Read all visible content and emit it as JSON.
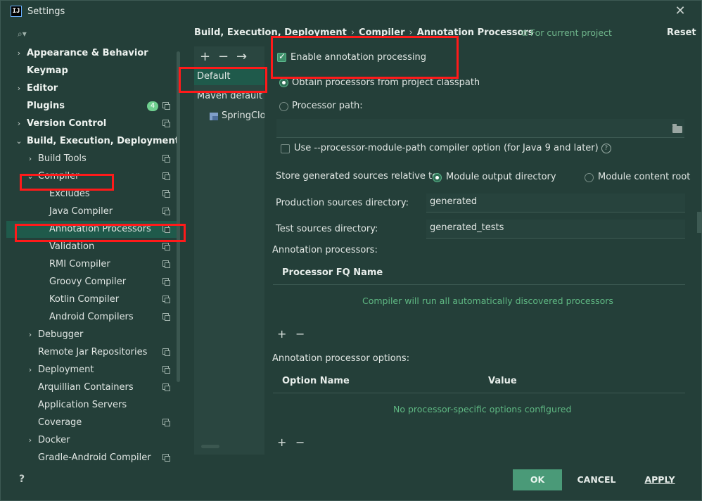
{
  "window": {
    "app_icon": "intellij-icon",
    "title": "Settings",
    "close_glyph": "✕"
  },
  "search": {
    "icon": "search-icon",
    "glyph": "⌕▾"
  },
  "tree": [
    {
      "label": "Appearance & Behavior",
      "arrow": "›",
      "bold": true,
      "copy": false
    },
    {
      "label": "Keymap",
      "arrow": "",
      "bold": true,
      "copy": false
    },
    {
      "label": "Editor",
      "arrow": "›",
      "bold": true,
      "copy": false
    },
    {
      "label": "Plugins",
      "arrow": "",
      "bold": true,
      "copy": true,
      "badge": "4"
    },
    {
      "label": "Version Control",
      "arrow": "›",
      "bold": true,
      "copy": true
    },
    {
      "label": "Build, Execution, Deployment",
      "arrow": "⌄",
      "bold": true,
      "copy": false
    },
    {
      "label": "Build Tools",
      "arrow": "›",
      "bold": false,
      "copy": true
    },
    {
      "label": "Compiler",
      "arrow": "⌄",
      "bold": false,
      "copy": true
    },
    {
      "label": "Excludes",
      "arrow": "",
      "bold": false,
      "copy": true
    },
    {
      "label": "Java Compiler",
      "arrow": "",
      "bold": false,
      "copy": true
    },
    {
      "label": "Annotation Processors",
      "arrow": "",
      "bold": false,
      "copy": true,
      "selected": true
    },
    {
      "label": "Validation",
      "arrow": "",
      "bold": false,
      "copy": true
    },
    {
      "label": "RMI Compiler",
      "arrow": "",
      "bold": false,
      "copy": true
    },
    {
      "label": "Groovy Compiler",
      "arrow": "",
      "bold": false,
      "copy": true
    },
    {
      "label": "Kotlin Compiler",
      "arrow": "",
      "bold": false,
      "copy": true
    },
    {
      "label": "Android Compilers",
      "arrow": "",
      "bold": false,
      "copy": true
    },
    {
      "label": "Debugger",
      "arrow": "›",
      "bold": false,
      "copy": false
    },
    {
      "label": "Remote Jar Repositories",
      "arrow": "",
      "bold": false,
      "copy": true
    },
    {
      "label": "Deployment",
      "arrow": "›",
      "bold": false,
      "copy": true
    },
    {
      "label": "Arquillian Containers",
      "arrow": "",
      "bold": false,
      "copy": true
    },
    {
      "label": "Application Servers",
      "arrow": "",
      "bold": false,
      "copy": false
    },
    {
      "label": "Coverage",
      "arrow": "",
      "bold": false,
      "copy": true
    },
    {
      "label": "Docker",
      "arrow": "›",
      "bold": false,
      "copy": false
    },
    {
      "label": "Gradle-Android Compiler",
      "arrow": "",
      "bold": false,
      "copy": true
    }
  ],
  "breadcrumb": {
    "parts": [
      "Build, Execution, Deployment",
      "Compiler",
      "Annotation Processors"
    ],
    "separator": "›",
    "for_project": "For current project",
    "reset": "Reset"
  },
  "profiles": {
    "tools": [
      "+",
      "−",
      "→"
    ],
    "items": [
      "Default",
      "Maven default a",
      "SpringClo"
    ]
  },
  "processing": {
    "enable_label": "Enable annotation processing",
    "enable_checked": true,
    "obtain_label": "Obtain processors from project classpath",
    "processor_path_label": "Processor path:",
    "processor_path_value": "",
    "module_path_label": "Use --processor-module-path compiler option (for Java 9 and later)",
    "module_path_checked": false,
    "help_glyph": "?",
    "store_label": "Store generated sources relative to:",
    "store_options": [
      "Module output directory",
      "Module content root"
    ],
    "store_selected": "Module output directory",
    "prod_label": "Production sources directory:",
    "prod_value": "generated",
    "test_label": "Test sources directory:",
    "test_value": "generated_tests"
  },
  "processors_table": {
    "title": "Annotation processors:",
    "column": "Processor FQ Name",
    "empty": "Compiler will run all automatically discovered processors",
    "add": "+",
    "remove": "−"
  },
  "options_table": {
    "title": "Annotation processor options:",
    "columns": [
      "Option Name",
      "Value"
    ],
    "empty": "No processor-specific options configured",
    "add": "+",
    "remove": "−"
  },
  "footer": {
    "help": "?",
    "ok": "OK",
    "cancel": "CANCEL",
    "apply": "APPLY"
  },
  "colors": {
    "background": "#243f39",
    "selection": "#1f5a4b",
    "accent_green": "#5fb883",
    "highlight_box": "#ff1a1a"
  }
}
